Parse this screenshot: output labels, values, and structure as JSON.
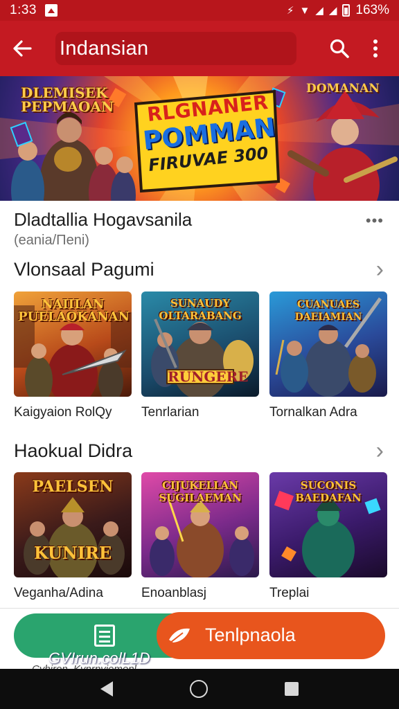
{
  "status_bar": {
    "time": "1:33",
    "battery_text": "163%"
  },
  "app_bar": {
    "title": "Indansian",
    "icons": [
      "back-arrow-icon",
      "search-icon",
      "more-vert-icon"
    ]
  },
  "banner": {
    "logo_left": "DLEMISEK PEPMAOAN",
    "headline_line1": "RLGNANER",
    "headline_line2": "POMMAN",
    "headline_line3": "FIRUVAE 300",
    "logo_right": "DOMANAN"
  },
  "app_info": {
    "name": "Dladtallia Hogavsanila",
    "subtitle": "(eania/Πeni)"
  },
  "sections": [
    {
      "title": "Vlonsaal Pagumi",
      "cards": [
        {
          "label": "Kaigyaion RolQy",
          "thumb_title": "NAIILAN PUELAOKANAN"
        },
        {
          "label": "Tenrlarian",
          "thumb_title": "SUNAUDY OLTARABANG",
          "thumb_banner": "RUNGERE"
        },
        {
          "label": "Tornalkan Adra",
          "thumb_title": "CUANUAES DAEIAMIAN"
        }
      ]
    },
    {
      "title": "Haokual Didra",
      "cards": [
        {
          "label": "Veganha/Adina",
          "thumb_title": "PAELSEN",
          "thumb_banner": "KUNIRE"
        },
        {
          "label": "Enoanblasj",
          "thumb_title": "CIJUKELLAN SUGILAEMAN"
        },
        {
          "label": "Treplai",
          "thumb_title": "SUCONIS BAEDAFAN"
        }
      ]
    }
  ],
  "actions": {
    "left_label": "GVIrun.colL1D",
    "right_label": "Tenlpnaola",
    "peek_text": "Cvhiron..Kvnrnviemonl"
  },
  "colors": {
    "status_bar": "#b8161c",
    "app_bar": "#c41a22",
    "left_action": "#2aa46e",
    "right_action": "#e8551d",
    "nav_bar": "#0d0d0d"
  }
}
